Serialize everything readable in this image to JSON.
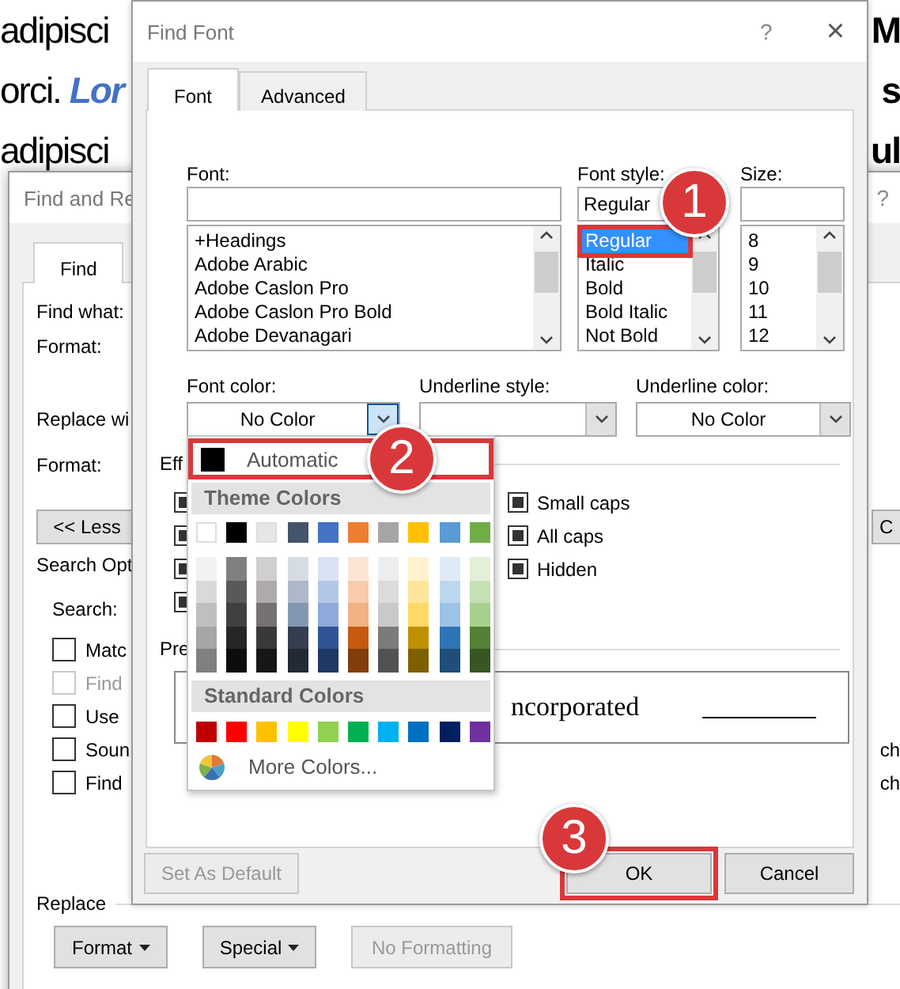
{
  "document": {
    "lines": [
      {
        "left": "adipisci",
        "right": "M"
      },
      {
        "left": "orci. *Lor*",
        "right": "s"
      },
      {
        "left": "adipisci",
        "right": "ul"
      }
    ]
  },
  "find_replace": {
    "title": "Find and Re",
    "help": "?",
    "tabs": [
      {
        "label": "Find",
        "selected": true
      }
    ],
    "find_label": "Find what:",
    "find_format_label": "Format:",
    "replace_label": "Replace wi",
    "replace_format_label": "Format:",
    "less_button": "<< Less",
    "right_button": "C",
    "search_options_label": "Search Opt",
    "search_label": "Search:",
    "options": [
      {
        "label": "Matc",
        "checked": false,
        "disabled": false
      },
      {
        "label": "Find",
        "checked": false,
        "disabled": true
      },
      {
        "label": "Use",
        "checked": false,
        "disabled": false
      },
      {
        "label": "Soun",
        "checked": false,
        "disabled": false,
        "right_text": "ch"
      },
      {
        "label": "Find",
        "checked": false,
        "disabled": false,
        "right_text": "ch"
      }
    ],
    "replace_group_label": "Replace",
    "buttons": [
      {
        "label": "Format",
        "menu": true,
        "disabled": false
      },
      {
        "label": "Special",
        "menu": true,
        "disabled": false
      },
      {
        "label": "No Formatting",
        "menu": false,
        "disabled": true
      }
    ]
  },
  "find_font": {
    "title": "Find Font",
    "help": "?",
    "close": "×",
    "tabs": [
      {
        "label": "Font",
        "selected": true
      },
      {
        "label": "Advanced",
        "selected": false
      }
    ],
    "font": {
      "label": "Font:",
      "items": [
        {
          "label": "+Headings",
          "selected": false
        },
        {
          "label": "Adobe Arabic",
          "selected": false
        },
        {
          "label": "Adobe Caslon Pro",
          "selected": false
        },
        {
          "label": "Adobe Caslon Pro Bold",
          "selected": false
        },
        {
          "label": "Adobe Devanagari",
          "selected": false
        }
      ]
    },
    "font_style": {
      "label": "Font style:",
      "value": "Regular",
      "items": [
        {
          "label": "Regular",
          "selected": true,
          "callout": "1"
        },
        {
          "label": "Italic",
          "selected": false
        },
        {
          "label": "Bold",
          "selected": false
        },
        {
          "label": "Bold Italic",
          "selected": false
        },
        {
          "label": "Not Bold",
          "selected": false
        }
      ]
    },
    "size": {
      "label": "Size:",
      "items": [
        {
          "label": "8",
          "selected": false
        },
        {
          "label": "9",
          "selected": false
        },
        {
          "label": "10",
          "selected": false
        },
        {
          "label": "11",
          "selected": false
        },
        {
          "label": "12",
          "selected": false
        }
      ]
    },
    "font_color": {
      "label": "Font color:",
      "value": "No Color",
      "open": true
    },
    "underline_style": {
      "label": "Underline style:",
      "open": false
    },
    "underline_color": {
      "label": "Underline color:",
      "value": "No Color",
      "open": false
    },
    "effects_label": "Eff",
    "effects_left": [
      {
        "indeterminate": true
      },
      {
        "indeterminate": true
      },
      {
        "indeterminate": true
      },
      {
        "indeterminate": true
      }
    ],
    "effects_right": [
      {
        "label": "Small caps",
        "indeterminate": true
      },
      {
        "label": "All caps",
        "indeterminate": true
      },
      {
        "label": "Hidden",
        "indeterminate": true
      }
    ],
    "preview_label": "Pre",
    "preview_text": "ncorporated",
    "buttons": [
      {
        "label": "Set As Default",
        "disabled": true
      },
      {
        "label": "OK",
        "disabled": false,
        "callout": "3"
      },
      {
        "label": "Cancel",
        "disabled": false
      }
    ]
  },
  "color_menu": {
    "automatic": {
      "label": "Automatic",
      "color": "#000000",
      "callout": "2"
    },
    "theme_title": "Theme Colors",
    "theme_colors": [
      {
        "color": "#ffffff",
        "shades": [
          {
            "color": "#f2f2f2"
          },
          {
            "color": "#d9d9d9"
          },
          {
            "color": "#bfbfbf"
          },
          {
            "color": "#a6a6a6"
          },
          {
            "color": "#808080"
          }
        ]
      },
      {
        "color": "#000000",
        "shades": [
          {
            "color": "#808080"
          },
          {
            "color": "#595959"
          },
          {
            "color": "#404040"
          },
          {
            "color": "#262626"
          },
          {
            "color": "#0d0d0d"
          }
        ]
      },
      {
        "color": "#e7e6e6",
        "shades": [
          {
            "color": "#d0cece"
          },
          {
            "color": "#aeaaaa"
          },
          {
            "color": "#757171"
          },
          {
            "color": "#3a3838"
          },
          {
            "color": "#171616"
          }
        ]
      },
      {
        "color": "#44546a",
        "shades": [
          {
            "color": "#d6dce4"
          },
          {
            "color": "#adb9ca"
          },
          {
            "color": "#8497b0"
          },
          {
            "color": "#333f4f"
          },
          {
            "color": "#222a35"
          }
        ]
      },
      {
        "color": "#4472c4",
        "shades": [
          {
            "color": "#d9e2f3"
          },
          {
            "color": "#b4c6e7"
          },
          {
            "color": "#8eaadb"
          },
          {
            "color": "#2f5496"
          },
          {
            "color": "#1f3864"
          }
        ]
      },
      {
        "color": "#ed7d31",
        "shades": [
          {
            "color": "#fbe5d5"
          },
          {
            "color": "#f7cbac"
          },
          {
            "color": "#f4b183"
          },
          {
            "color": "#c55a11"
          },
          {
            "color": "#833c0b"
          }
        ]
      },
      {
        "color": "#a5a5a5",
        "shades": [
          {
            "color": "#ededed"
          },
          {
            "color": "#dbdbdb"
          },
          {
            "color": "#c9c9c9"
          },
          {
            "color": "#7b7b7b"
          },
          {
            "color": "#525252"
          }
        ]
      },
      {
        "color": "#ffc000",
        "shades": [
          {
            "color": "#fff2cc"
          },
          {
            "color": "#fee599"
          },
          {
            "color": "#ffd965"
          },
          {
            "color": "#bf9000"
          },
          {
            "color": "#7f6000"
          }
        ]
      },
      {
        "color": "#5b9bd5",
        "shades": [
          {
            "color": "#deebf6"
          },
          {
            "color": "#bdd7ee"
          },
          {
            "color": "#9cc3e5"
          },
          {
            "color": "#2e75b5"
          },
          {
            "color": "#1e4e79"
          }
        ]
      },
      {
        "color": "#70ad47",
        "shades": [
          {
            "color": "#e2efd9"
          },
          {
            "color": "#c5e0b3"
          },
          {
            "color": "#a8d08d"
          },
          {
            "color": "#538135"
          },
          {
            "color": "#375623"
          }
        ]
      }
    ],
    "standard_title": "Standard Colors",
    "standard_colors": [
      {
        "color": "#c00000"
      },
      {
        "color": "#ff0000"
      },
      {
        "color": "#ffc000"
      },
      {
        "color": "#ffff00"
      },
      {
        "color": "#92d050"
      },
      {
        "color": "#00b050"
      },
      {
        "color": "#00b0f0"
      },
      {
        "color": "#0070c0"
      },
      {
        "color": "#002060"
      },
      {
        "color": "#7030a0"
      }
    ],
    "more": "More Colors..."
  }
}
